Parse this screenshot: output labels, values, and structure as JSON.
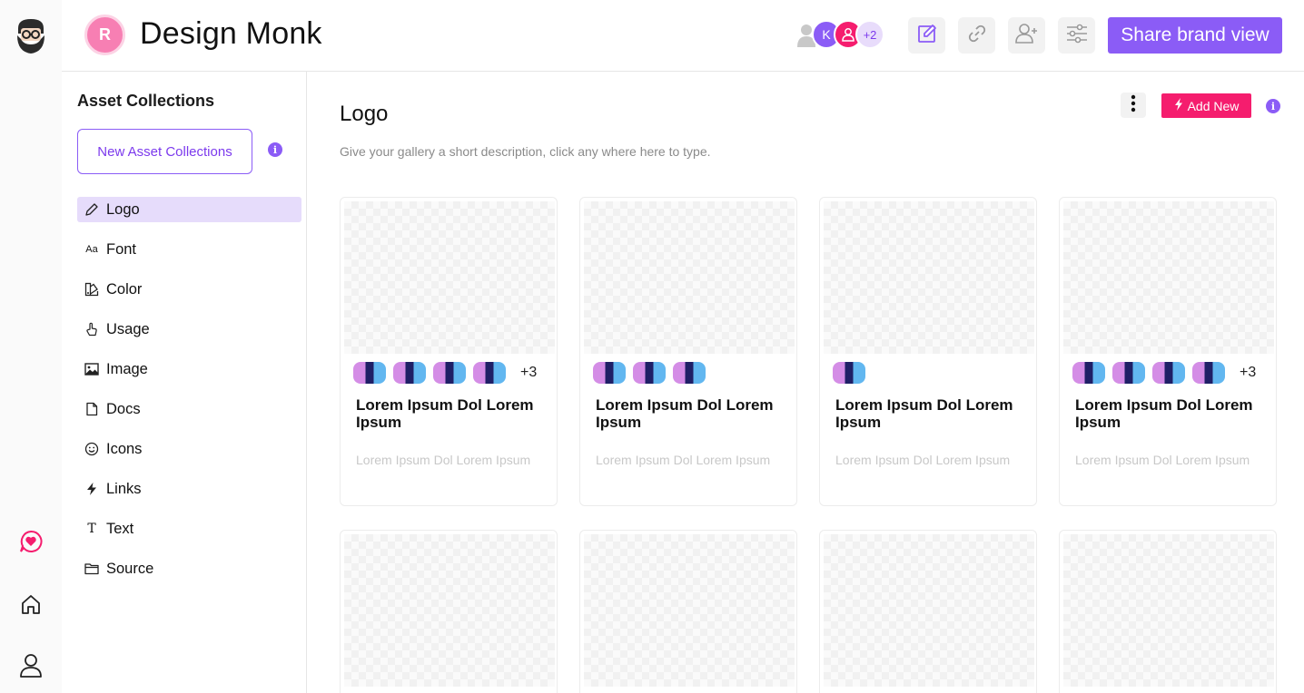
{
  "brand": {
    "logo_icon": "bearded-man-logo-icon"
  },
  "rail": {
    "items": [
      "heart-chat-icon",
      "home-icon",
      "user-icon"
    ]
  },
  "header": {
    "workspace_initial": "R",
    "workspace_name": "Design Monk",
    "avatars": {
      "initial": "K",
      "more_count": "+2"
    },
    "actions": [
      "edit-icon",
      "link-icon",
      "add-user-icon",
      "sliders-icon"
    ],
    "share_label": "Share brand view"
  },
  "sidebar": {
    "title": "Asset Collections",
    "new_collection_label": "New Asset Collections",
    "items": [
      {
        "label": "Logo",
        "icon": "pencil-icon",
        "active": true
      },
      {
        "label": "Font",
        "icon": "font-icon"
      },
      {
        "label": "Color",
        "icon": "palette-icon"
      },
      {
        "label": "Usage",
        "icon": "hand-pointer-icon"
      },
      {
        "label": "Image",
        "icon": "image-icon"
      },
      {
        "label": "Docs",
        "icon": "document-icon"
      },
      {
        "label": "Icons",
        "icon": "smiley-icon"
      },
      {
        "label": "Links",
        "icon": "bolt-icon"
      },
      {
        "label": "Text",
        "icon": "text-icon"
      },
      {
        "label": "Source",
        "icon": "folder-icon"
      }
    ]
  },
  "main": {
    "title": "Logo",
    "description": "Give your gallery a short description, click any where here to type.",
    "add_new_label": "Add New",
    "cards": [
      {
        "title": "Lorem Ipsum Dol Lorem Ipsum",
        "subtitle": "Lorem Ipsum Dol Lorem Ipsum",
        "swatch_count": 4,
        "more": "+3"
      },
      {
        "title": "Lorem Ipsum Dol Lorem Ipsum",
        "subtitle": "Lorem Ipsum Dol Lorem Ipsum",
        "swatch_count": 3,
        "more": ""
      },
      {
        "title": "Lorem Ipsum Dol Lorem Ipsum",
        "subtitle": "Lorem Ipsum Dol Lorem Ipsum",
        "swatch_count": 1,
        "more": ""
      },
      {
        "title": "Lorem Ipsum Dol Lorem Ipsum",
        "subtitle": "Lorem Ipsum Dol Lorem Ipsum",
        "swatch_count": 4,
        "more": "+3"
      },
      {
        "title": "",
        "subtitle": "",
        "swatch_count": 0,
        "more": ""
      },
      {
        "title": "",
        "subtitle": "",
        "swatch_count": 0,
        "more": ""
      },
      {
        "title": "",
        "subtitle": "",
        "swatch_count": 0,
        "more": ""
      },
      {
        "title": "",
        "subtitle": "",
        "swatch_count": 0,
        "more": ""
      }
    ]
  },
  "colors": {
    "accent": "#8b5cf6",
    "pink": "#f51d6e",
    "active_bg": "#e6dcfb"
  }
}
